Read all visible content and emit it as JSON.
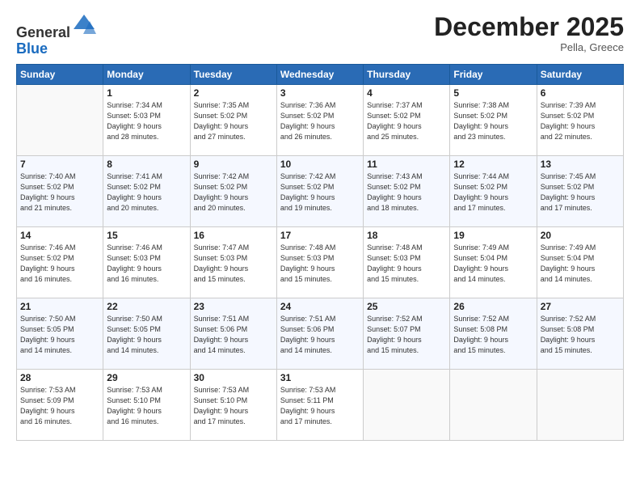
{
  "header": {
    "logo_line1": "General",
    "logo_line2": "Blue",
    "month_title": "December 2025",
    "location": "Pella, Greece"
  },
  "days_of_week": [
    "Sunday",
    "Monday",
    "Tuesday",
    "Wednesday",
    "Thursday",
    "Friday",
    "Saturday"
  ],
  "weeks": [
    [
      {
        "day": "",
        "info": ""
      },
      {
        "day": "1",
        "info": "Sunrise: 7:34 AM\nSunset: 5:03 PM\nDaylight: 9 hours\nand 28 minutes."
      },
      {
        "day": "2",
        "info": "Sunrise: 7:35 AM\nSunset: 5:02 PM\nDaylight: 9 hours\nand 27 minutes."
      },
      {
        "day": "3",
        "info": "Sunrise: 7:36 AM\nSunset: 5:02 PM\nDaylight: 9 hours\nand 26 minutes."
      },
      {
        "day": "4",
        "info": "Sunrise: 7:37 AM\nSunset: 5:02 PM\nDaylight: 9 hours\nand 25 minutes."
      },
      {
        "day": "5",
        "info": "Sunrise: 7:38 AM\nSunset: 5:02 PM\nDaylight: 9 hours\nand 23 minutes."
      },
      {
        "day": "6",
        "info": "Sunrise: 7:39 AM\nSunset: 5:02 PM\nDaylight: 9 hours\nand 22 minutes."
      }
    ],
    [
      {
        "day": "7",
        "info": "Sunrise: 7:40 AM\nSunset: 5:02 PM\nDaylight: 9 hours\nand 21 minutes."
      },
      {
        "day": "8",
        "info": "Sunrise: 7:41 AM\nSunset: 5:02 PM\nDaylight: 9 hours\nand 20 minutes."
      },
      {
        "day": "9",
        "info": "Sunrise: 7:42 AM\nSunset: 5:02 PM\nDaylight: 9 hours\nand 20 minutes."
      },
      {
        "day": "10",
        "info": "Sunrise: 7:42 AM\nSunset: 5:02 PM\nDaylight: 9 hours\nand 19 minutes."
      },
      {
        "day": "11",
        "info": "Sunrise: 7:43 AM\nSunset: 5:02 PM\nDaylight: 9 hours\nand 18 minutes."
      },
      {
        "day": "12",
        "info": "Sunrise: 7:44 AM\nSunset: 5:02 PM\nDaylight: 9 hours\nand 17 minutes."
      },
      {
        "day": "13",
        "info": "Sunrise: 7:45 AM\nSunset: 5:02 PM\nDaylight: 9 hours\nand 17 minutes."
      }
    ],
    [
      {
        "day": "14",
        "info": "Sunrise: 7:46 AM\nSunset: 5:02 PM\nDaylight: 9 hours\nand 16 minutes."
      },
      {
        "day": "15",
        "info": "Sunrise: 7:46 AM\nSunset: 5:03 PM\nDaylight: 9 hours\nand 16 minutes."
      },
      {
        "day": "16",
        "info": "Sunrise: 7:47 AM\nSunset: 5:03 PM\nDaylight: 9 hours\nand 15 minutes."
      },
      {
        "day": "17",
        "info": "Sunrise: 7:48 AM\nSunset: 5:03 PM\nDaylight: 9 hours\nand 15 minutes."
      },
      {
        "day": "18",
        "info": "Sunrise: 7:48 AM\nSunset: 5:03 PM\nDaylight: 9 hours\nand 15 minutes."
      },
      {
        "day": "19",
        "info": "Sunrise: 7:49 AM\nSunset: 5:04 PM\nDaylight: 9 hours\nand 14 minutes."
      },
      {
        "day": "20",
        "info": "Sunrise: 7:49 AM\nSunset: 5:04 PM\nDaylight: 9 hours\nand 14 minutes."
      }
    ],
    [
      {
        "day": "21",
        "info": "Sunrise: 7:50 AM\nSunset: 5:05 PM\nDaylight: 9 hours\nand 14 minutes."
      },
      {
        "day": "22",
        "info": "Sunrise: 7:50 AM\nSunset: 5:05 PM\nDaylight: 9 hours\nand 14 minutes."
      },
      {
        "day": "23",
        "info": "Sunrise: 7:51 AM\nSunset: 5:06 PM\nDaylight: 9 hours\nand 14 minutes."
      },
      {
        "day": "24",
        "info": "Sunrise: 7:51 AM\nSunset: 5:06 PM\nDaylight: 9 hours\nand 14 minutes."
      },
      {
        "day": "25",
        "info": "Sunrise: 7:52 AM\nSunset: 5:07 PM\nDaylight: 9 hours\nand 15 minutes."
      },
      {
        "day": "26",
        "info": "Sunrise: 7:52 AM\nSunset: 5:08 PM\nDaylight: 9 hours\nand 15 minutes."
      },
      {
        "day": "27",
        "info": "Sunrise: 7:52 AM\nSunset: 5:08 PM\nDaylight: 9 hours\nand 15 minutes."
      }
    ],
    [
      {
        "day": "28",
        "info": "Sunrise: 7:53 AM\nSunset: 5:09 PM\nDaylight: 9 hours\nand 16 minutes."
      },
      {
        "day": "29",
        "info": "Sunrise: 7:53 AM\nSunset: 5:10 PM\nDaylight: 9 hours\nand 16 minutes."
      },
      {
        "day": "30",
        "info": "Sunrise: 7:53 AM\nSunset: 5:10 PM\nDaylight: 9 hours\nand 17 minutes."
      },
      {
        "day": "31",
        "info": "Sunrise: 7:53 AM\nSunset: 5:11 PM\nDaylight: 9 hours\nand 17 minutes."
      },
      {
        "day": "",
        "info": ""
      },
      {
        "day": "",
        "info": ""
      },
      {
        "day": "",
        "info": ""
      }
    ]
  ]
}
